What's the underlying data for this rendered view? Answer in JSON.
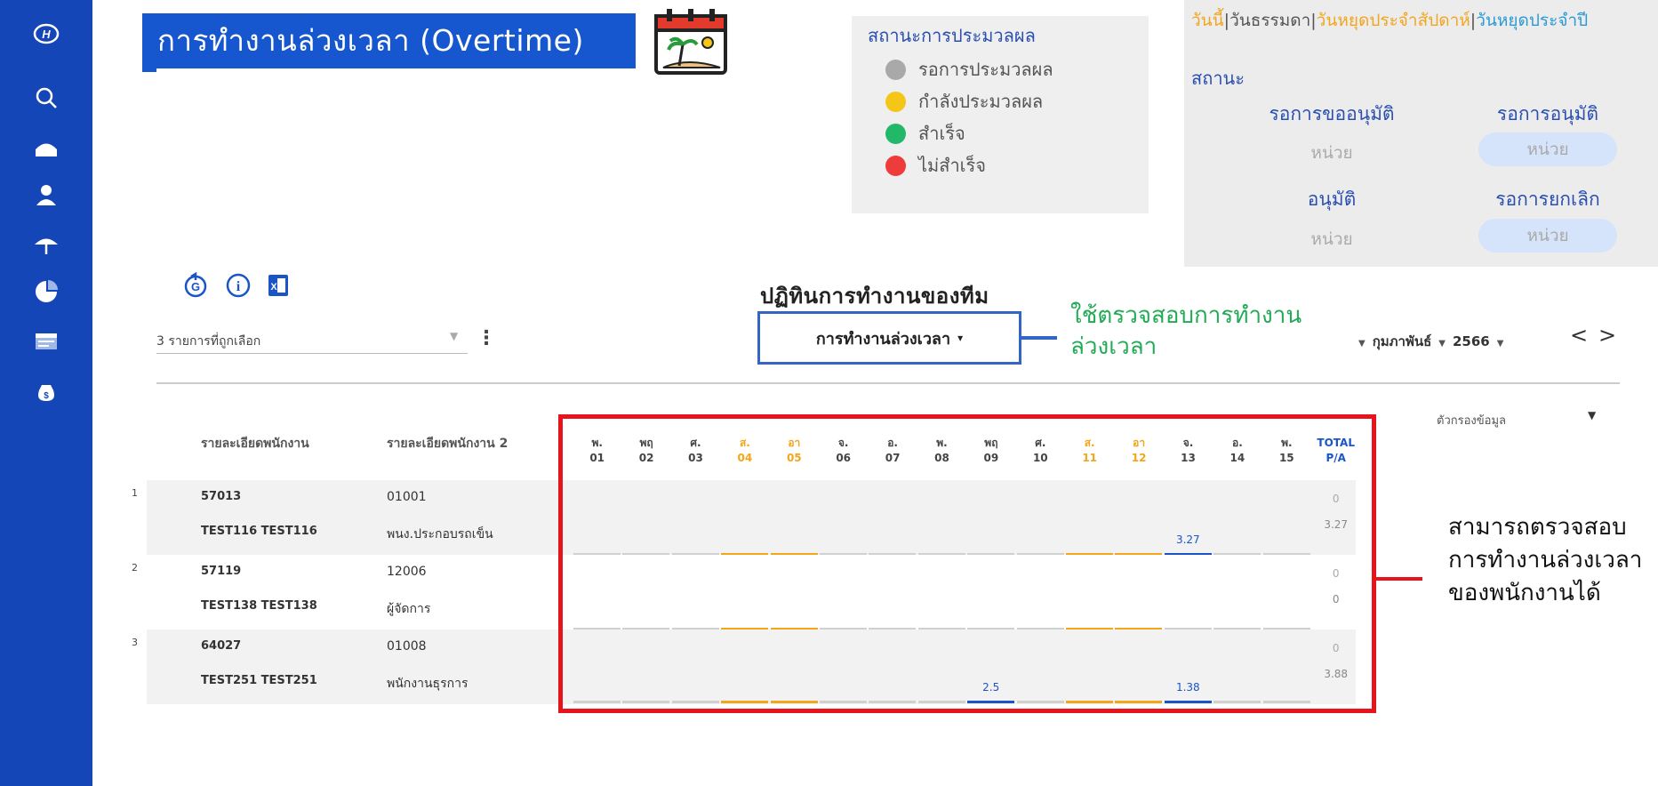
{
  "colors": {
    "sidebar": "#1446b8",
    "title_bg": "#1657cf",
    "weekend": "#f3a51c",
    "ot_bar": "#1a55c8",
    "highlight_box": "#e8141c",
    "callout_green": "#22aa55"
  },
  "sidebar": {
    "icons": [
      "brand-logo-icon",
      "search-icon",
      "home-icon",
      "user-icon",
      "umbrella-icon",
      "pie-chart-icon",
      "payslip-icon",
      "money-bag-icon"
    ]
  },
  "header": {
    "title": "การทำงานล่วงเวลา (Overtime)"
  },
  "status_legend": {
    "title": "สถานะการประมวลผล",
    "items": [
      {
        "label": "รอการประมวลผล",
        "color": "#a9a9a9"
      },
      {
        "label": "กำลังประมวลผล",
        "color": "#f5c518"
      },
      {
        "label": "สำเร็จ",
        "color": "#22b86a"
      },
      {
        "label": "ไม่สำเร็จ",
        "color": "#ee3b3b"
      }
    ]
  },
  "right_panel": {
    "day_types": [
      "วันนี้",
      "วันธรรมดา",
      "วันหยุดประจำสัปดาห์",
      "วันหยุดประจำปี"
    ],
    "sep": "|",
    "state_label": "สถานะ",
    "pending_request": "รอการขออนุมัติ",
    "pending_approval": "รอการอนุมัติ",
    "approved": "อนุมัติ",
    "pending_cancel": "รอการยกเลิก",
    "unit": "หน่วย"
  },
  "selection": {
    "text": "3 รายการที่ถูกเลือก"
  },
  "team": {
    "title": "ปฏิทินการทำงานของทีม",
    "dropdown": "การทำงานล่วงเวลา",
    "callout_line1": "ใช้ตรวจสอบการทำงาน",
    "callout_line2": "ล่วงเวลา"
  },
  "period": {
    "month": "กุมภาพันธ์",
    "year": "2566",
    "prev": "<",
    "next": ">"
  },
  "filter": {
    "label": "ตัวกรองข้อมูล"
  },
  "table": {
    "col1": "รายละเอียดพนักงาน",
    "col2": "รายละเอียดพนักงาน 2",
    "days": [
      {
        "d": "พ.",
        "n": "01",
        "we": false
      },
      {
        "d": "พฤ",
        "n": "02",
        "we": false
      },
      {
        "d": "ศ.",
        "n": "03",
        "we": false
      },
      {
        "d": "ส.",
        "n": "04",
        "we": true
      },
      {
        "d": "อา",
        "n": "05",
        "we": true
      },
      {
        "d": "จ.",
        "n": "06",
        "we": false
      },
      {
        "d": "อ.",
        "n": "07",
        "we": false
      },
      {
        "d": "พ.",
        "n": "08",
        "we": false
      },
      {
        "d": "พฤ",
        "n": "09",
        "we": false
      },
      {
        "d": "ศ.",
        "n": "10",
        "we": false
      },
      {
        "d": "ส.",
        "n": "11",
        "we": true
      },
      {
        "d": "อา",
        "n": "12",
        "we": true
      },
      {
        "d": "จ.",
        "n": "13",
        "we": false
      },
      {
        "d": "อ.",
        "n": "14",
        "we": false
      },
      {
        "d": "พ.",
        "n": "15",
        "we": false
      }
    ],
    "total_top": "TOTAL",
    "total_bottom": "P/A",
    "rows": [
      {
        "num": "1",
        "id": "57013",
        "name": "TEST116 TEST116",
        "code": "01001",
        "position": "พนง.ประกอบรถเข็น",
        "ot": {
          "13": "3.27"
        },
        "pending": "0",
        "approved_total": "3.27"
      },
      {
        "num": "2",
        "id": "57119",
        "name": "TEST138 TEST138",
        "code": "12006",
        "position": "ผู้จัดการ",
        "ot": {},
        "pending": "0",
        "approved_total": "0"
      },
      {
        "num": "3",
        "id": "64027",
        "name": "TEST251 TEST251",
        "code": "01008",
        "position": "พนักงานธุรการ",
        "ot": {
          "09": "2.5",
          "13": "1.38"
        },
        "pending": "0",
        "approved_total": "3.88"
      }
    ]
  },
  "annotation": {
    "line1": "สามารถตรวจสอบ",
    "line2": "การทำงานล่วงเวลา",
    "line3": "ของพนักงานได้"
  }
}
